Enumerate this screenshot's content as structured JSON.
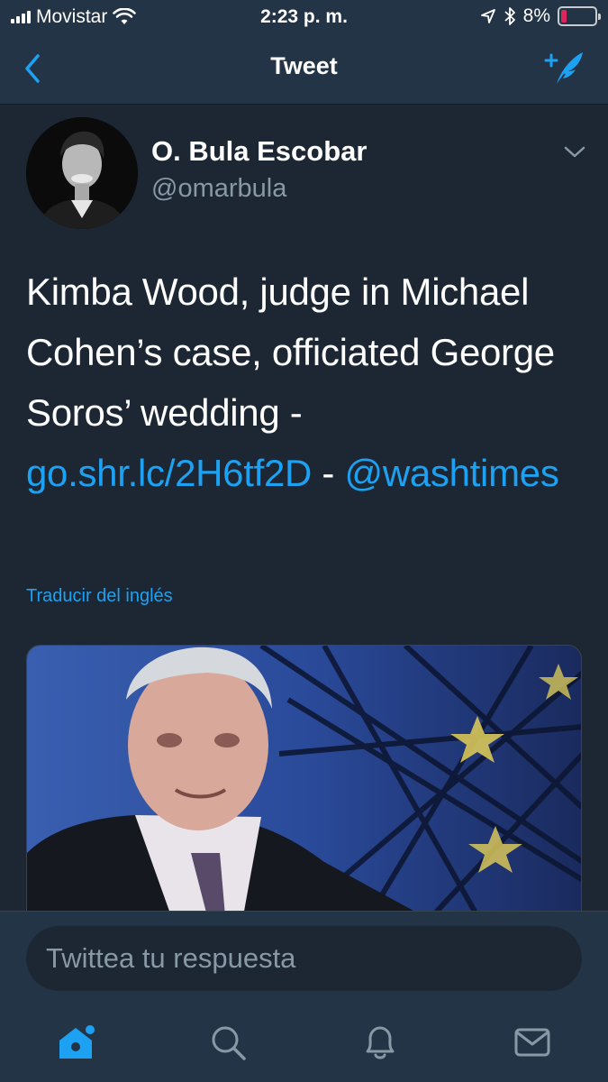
{
  "status_bar": {
    "carrier": "Movistar",
    "time": "2:23 p. m.",
    "battery_percent": "8%",
    "battery_level": 0.08,
    "icons": [
      "signal-icon",
      "wifi-icon",
      "location-icon",
      "bluetooth-icon",
      "battery-icon"
    ]
  },
  "nav": {
    "title": "Tweet",
    "back_icon": "chevron-left-icon",
    "compose_icon": "compose-tweet-icon"
  },
  "tweet": {
    "author_name": "O. Bula Escobar",
    "author_handle": "@omarbula",
    "text_part1": "Kimba Wood, judge in Michael Cohen’s case, officiated George Soros’ wedding - ",
    "link": "go.shr.lc/2H6tf2D",
    "text_part2": " - ",
    "mention": "@washtimes",
    "translate_label": "Traducir del inglés"
  },
  "reply": {
    "placeholder": "Twittea tu respuesta"
  },
  "tabs": [
    {
      "name": "home-icon",
      "active": true
    },
    {
      "name": "search-icon",
      "active": false
    },
    {
      "name": "notifications-icon",
      "active": false
    },
    {
      "name": "messages-icon",
      "active": false
    }
  ],
  "colors": {
    "accent": "#1da1f2",
    "background": "#1c2733",
    "bar_background": "#243447",
    "secondary_text": "#8899a6",
    "battery_low": "#e0245e"
  }
}
